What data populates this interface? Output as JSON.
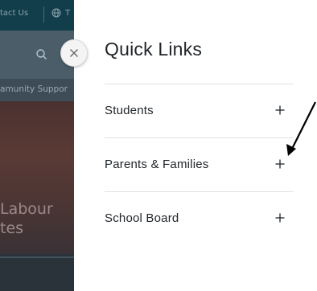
{
  "background_site": {
    "topbar": {
      "contact_label": "tact Us",
      "translate_partial": "T"
    },
    "nav_partial": "amunity Suppor",
    "hero_line1": "Labour",
    "hero_line2": "tes"
  },
  "panel": {
    "title": "Quick Links",
    "items": [
      {
        "label": "Students",
        "icon": "plus-icon"
      },
      {
        "label": "Parents & Families",
        "icon": "plus-icon"
      },
      {
        "label": "School Board",
        "icon": "plus-icon"
      }
    ]
  },
  "colors": {
    "title_text": "#1f2327",
    "item_text": "#20262b",
    "divider": "#e2e2e2",
    "topbar_bg": "#123d4a"
  }
}
